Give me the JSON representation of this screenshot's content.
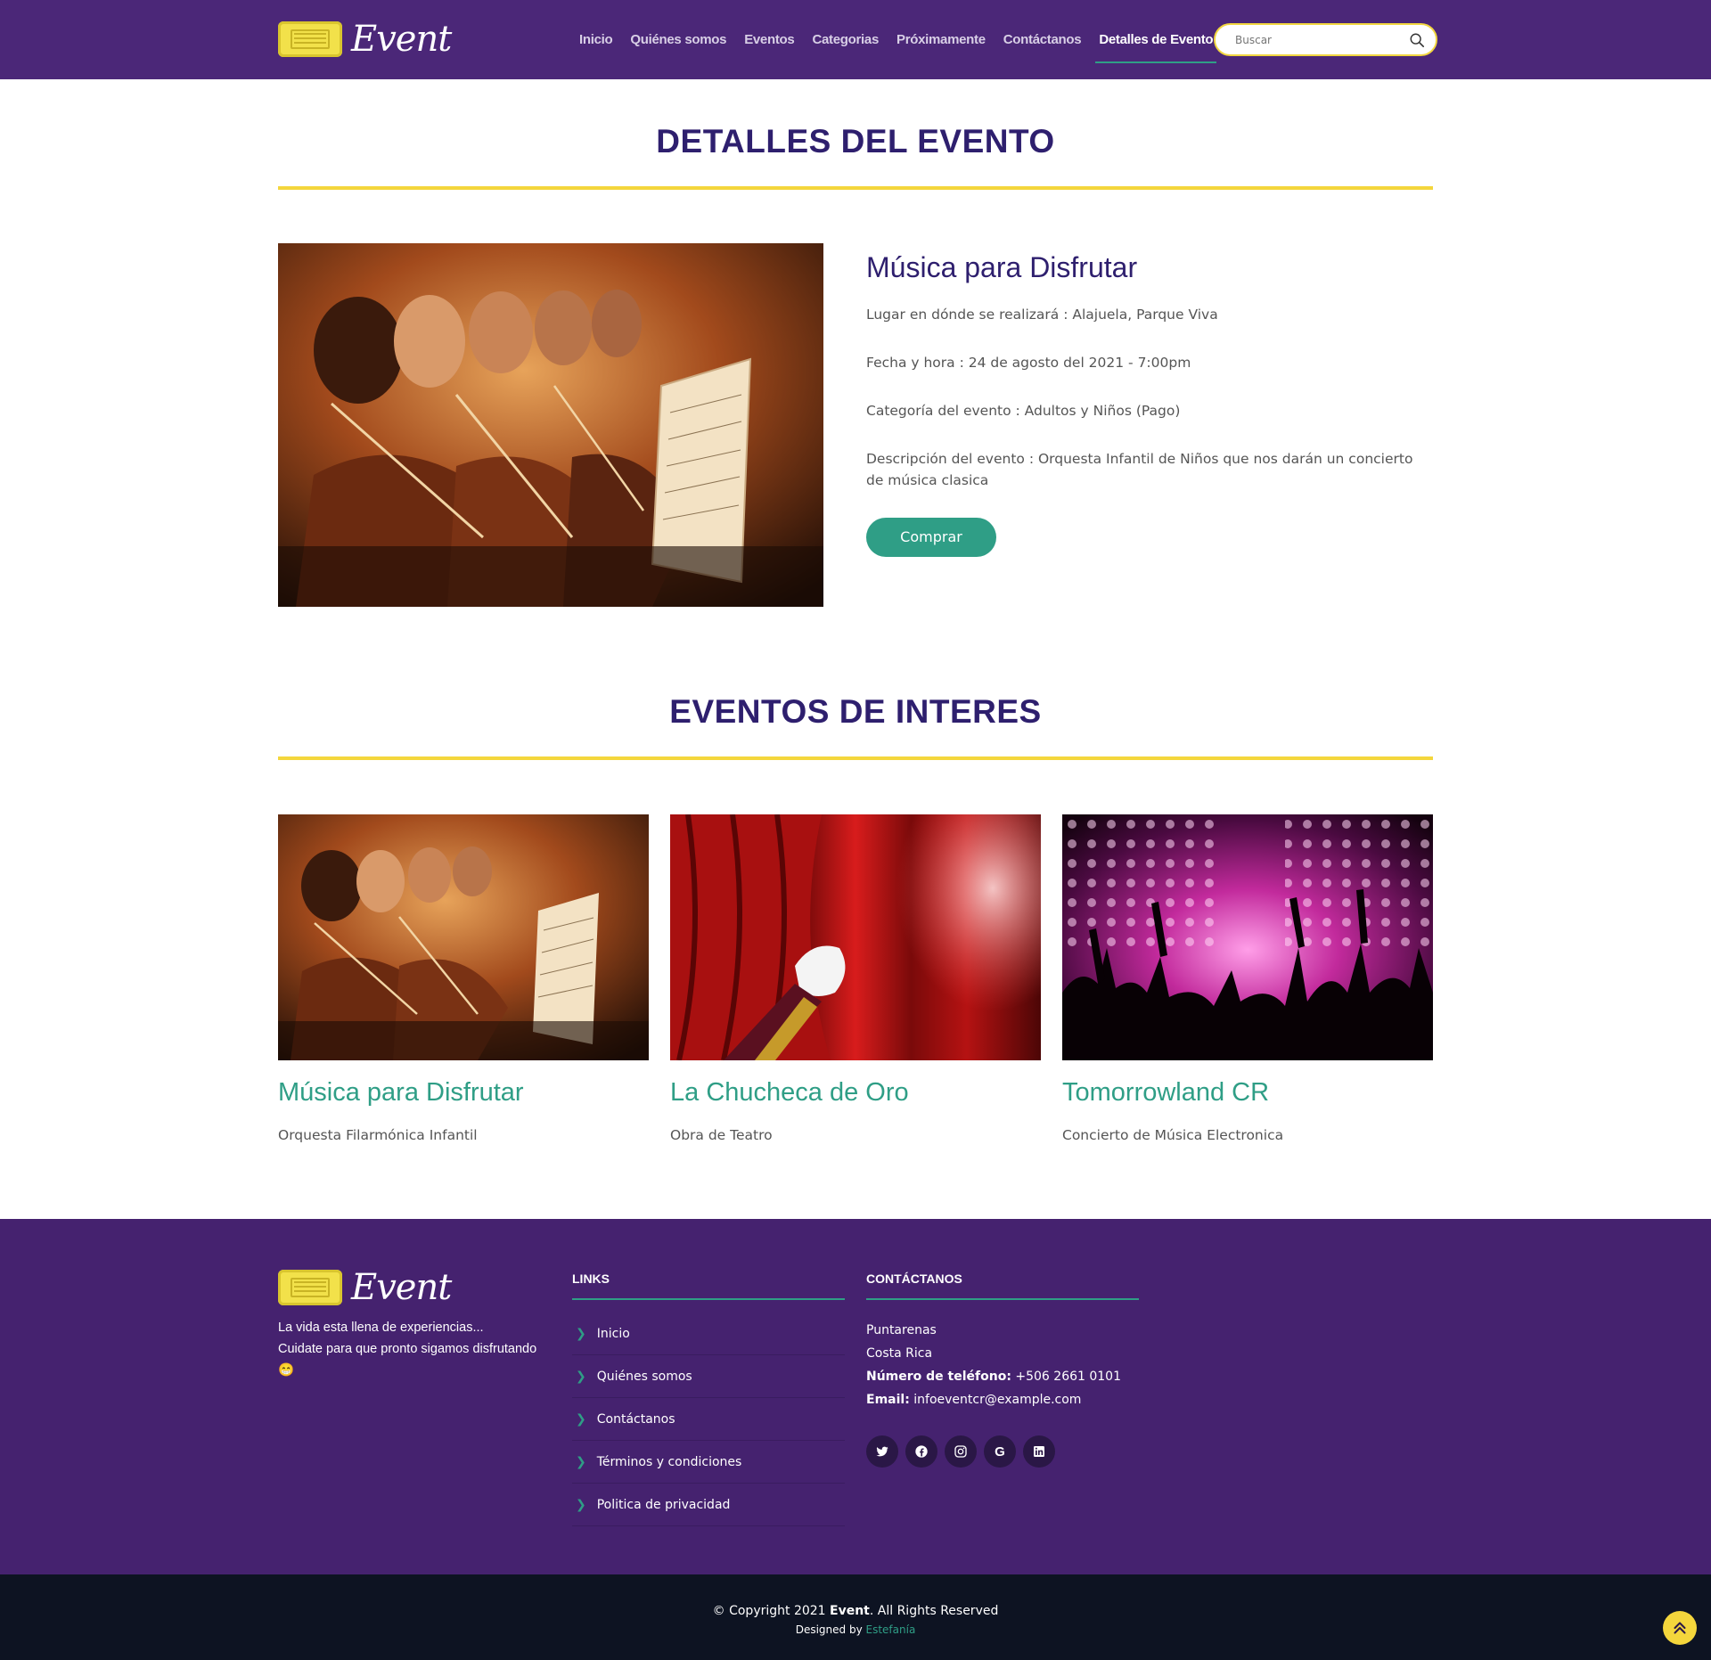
{
  "brand": {
    "name": "Event"
  },
  "nav": {
    "items": [
      "Inicio",
      "Quiénes somos",
      "Eventos",
      "Categorias",
      "Próximamente",
      "Contáctanos",
      "Detalles de Evento"
    ],
    "active_index": 6
  },
  "search": {
    "placeholder": "Buscar"
  },
  "details_section": {
    "title": "DETALLES DEL EVENTO",
    "event_name": "Música para Disfrutar",
    "place": "Lugar en dónde se realizará : Alajuela, Parque Viva",
    "datetime": "Fecha y hora : 24 de agosto del 2021 - 7:00pm",
    "category": "Categoría del evento : Adultos y Niños (Pago)",
    "description": "Descripción del evento : Orquesta Infantil de Niños que nos darán un concierto de música clasica",
    "buy_label": "Comprar"
  },
  "interest_section": {
    "title": "EVENTOS DE INTERES",
    "cards": [
      {
        "title": "Música para Disfrutar",
        "subtitle": "Orquesta Filarmónica Infantil",
        "image": "orchestra-photo"
      },
      {
        "title": "La Chucheca de Oro",
        "subtitle": "Obra de Teatro",
        "image": "theater-curtain-photo"
      },
      {
        "title": "Tomorrowland CR",
        "subtitle": "Concierto de Música Electronica",
        "image": "concert-crowd-photo"
      }
    ]
  },
  "footer": {
    "tagline_line1": "La vida esta llena de experiencias...",
    "tagline_line2": "Cuidate para que pronto sigamos disfrutando",
    "tagline_emoji": "😁",
    "links_title": "LINKS",
    "links": [
      "Inicio",
      "Quiénes somos",
      "Contáctanos",
      "Términos y condiciones",
      "Politica de privacidad"
    ],
    "contact_title": "CONTÁCTANOS",
    "city": "Puntarenas",
    "country": "Costa Rica",
    "phone_label": "Número de teléfono:",
    "phone": "+506 2661 0101",
    "email_label": "Email:",
    "email": "infoeventcr@example.com",
    "social_icons": [
      "twitter-icon",
      "facebook-icon",
      "instagram-icon",
      "google-icon",
      "linkedin-icon"
    ]
  },
  "bottom": {
    "copyright_prefix": "© Copyright 2021",
    "copyright_brand": "Event",
    "copyright_suffix": ". All Rights Reserved",
    "designed_prefix": "Designed by",
    "designed_author": "Estefanía"
  },
  "colors": {
    "header_bg": "#4b2778",
    "footer_bg": "#45226f",
    "title": "#2e1f6e",
    "accent_green": "#2f9e86",
    "accent_yellow": "#f4d63c",
    "bottom_bar": "#0d1322"
  }
}
